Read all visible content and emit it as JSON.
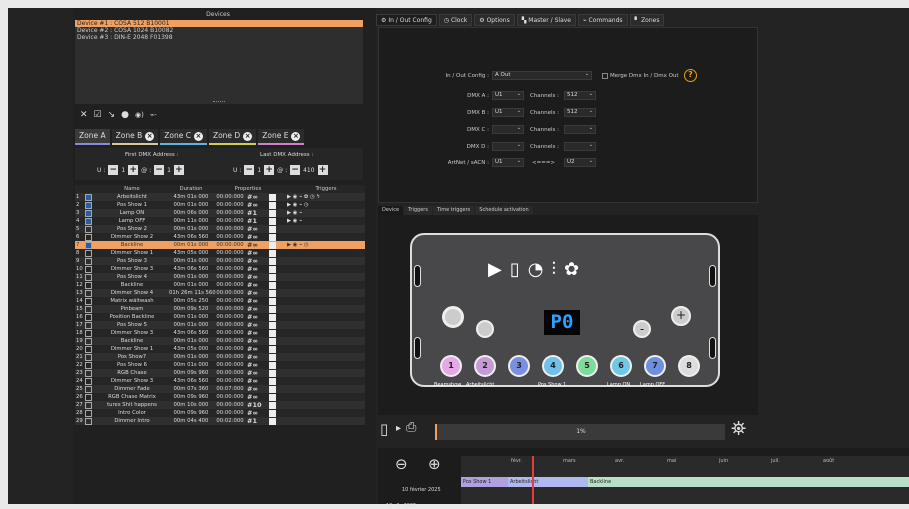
{
  "devices": {
    "title": "Devices",
    "items": [
      "Device #1 : COSA 512 B10001",
      "Device #2 : COSA 1024 B10082",
      "Device #3 : DIN-E 2048 F01398"
    ]
  },
  "zones": [
    "Zone A",
    "Zone B",
    "Zone C",
    "Zone D",
    "Zone E"
  ],
  "addr": {
    "first_label": "First DMX Address :",
    "last_label": "Last DMX Address :",
    "u": "U :",
    "at": "@ :",
    "first_u": "1",
    "first_at": "1",
    "last_u": "1",
    "last_at": "410"
  },
  "table": {
    "headers": [
      "Name",
      "Duration",
      "Properties",
      "Triggers"
    ],
    "rows": [
      {
        "n": "1",
        "name": "Arbeitslicht",
        "dur": "43m 01s 000",
        "prop": "00:00:000",
        "hash": "#∞",
        "on": true,
        "trg": "▶ ◉ ⌁ ✿ ◷ ϟ"
      },
      {
        "n": "2",
        "name": "Pos Show 1",
        "dur": "00m 01s 000",
        "prop": "00:00:000",
        "hash": "#∞",
        "on": true,
        "trg": "▶ ◉ ⌁       ◷"
      },
      {
        "n": "3",
        "name": "Lamp ON",
        "dur": "00m 06s 000",
        "prop": "00:00:000",
        "hash": "#1",
        "on": true,
        "trg": "▶ ◉ ⌁"
      },
      {
        "n": "4",
        "name": "Lamp OFF",
        "dur": "00m 11s 000",
        "prop": "00:00:000",
        "hash": "#1",
        "on": true,
        "trg": "▶ ◉ ⌁"
      },
      {
        "n": "5",
        "name": "Pos Show 2",
        "dur": "00m 01s 000",
        "prop": "00:00:000",
        "hash": "#∞",
        "on": false,
        "trg": ""
      },
      {
        "n": "6",
        "name": "Dimmer Show 2",
        "dur": "43m 06s 560",
        "prop": "00:00:000",
        "hash": "#∞",
        "on": false,
        "trg": ""
      },
      {
        "n": "7",
        "name": "Backline",
        "dur": "00m 01s 000",
        "prop": "00:00:000",
        "hash": "#∞",
        "on": true,
        "trg": "▶ ◉ ⌁       ◷",
        "sel": true
      },
      {
        "n": "8",
        "name": "Dimmer Show 1",
        "dur": "43m 05s 000",
        "prop": "00:00:000",
        "hash": "#∞",
        "on": false,
        "trg": ""
      },
      {
        "n": "9",
        "name": "Pos Show 3",
        "dur": "00m 01s 000",
        "prop": "00:00:000",
        "hash": "#∞",
        "on": false,
        "trg": ""
      },
      {
        "n": "10",
        "name": "Dimmer Show 3",
        "dur": "43m 06s 560",
        "prop": "00:00:000",
        "hash": "#∞",
        "on": false,
        "trg": ""
      },
      {
        "n": "11",
        "name": "Pos Show 4",
        "dur": "00m 01s 000",
        "prop": "00:00:000",
        "hash": "#∞",
        "on": false,
        "trg": ""
      },
      {
        "n": "12",
        "name": "Backline",
        "dur": "00m 01s 000",
        "prop": "00:00:000",
        "hash": "#∞",
        "on": false,
        "trg": ""
      },
      {
        "n": "13",
        "name": "Dimmer Show 4",
        "dur": "01h 26m 11s 560",
        "prop": "00:00:000",
        "hash": "#∞",
        "on": false,
        "trg": ""
      },
      {
        "n": "14",
        "name": "Matrix wäitwash",
        "dur": "00m 05s 250",
        "prop": "00:00:000",
        "hash": "#∞",
        "on": false,
        "trg": ""
      },
      {
        "n": "15",
        "name": "Pinbeam",
        "dur": "00m 09s 520",
        "prop": "00:00:000",
        "hash": "#∞",
        "on": false,
        "trg": ""
      },
      {
        "n": "16",
        "name": "Position Backline",
        "dur": "00m 01s 000",
        "prop": "00:00:000",
        "hash": "#∞",
        "on": false,
        "trg": ""
      },
      {
        "n": "17",
        "name": "Pos Show 5",
        "dur": "00m 01s 000",
        "prop": "00:00:000",
        "hash": "#∞",
        "on": false,
        "trg": ""
      },
      {
        "n": "18",
        "name": "Dimmer Show 3",
        "dur": "43m 06s 560",
        "prop": "00:00:000",
        "hash": "#∞",
        "on": false,
        "trg": ""
      },
      {
        "n": "19",
        "name": "Backline",
        "dur": "00m 01s 000",
        "prop": "00:00:000",
        "hash": "#∞",
        "on": false,
        "trg": ""
      },
      {
        "n": "20",
        "name": "Dimmer Show 1",
        "dur": "43m 05s 000",
        "prop": "00:00:000",
        "hash": "#∞",
        "on": false,
        "trg": ""
      },
      {
        "n": "21",
        "name": "Pos Show7",
        "dur": "00m 01s 000",
        "prop": "00:00:000",
        "hash": "#∞",
        "on": false,
        "trg": ""
      },
      {
        "n": "22",
        "name": "Pos Show 6",
        "dur": "00m 01s 000",
        "prop": "00:00:000",
        "hash": "#∞",
        "on": false,
        "trg": ""
      },
      {
        "n": "23",
        "name": "RGB Chase",
        "dur": "00m 09s 960",
        "prop": "00:00:000",
        "hash": "#∞",
        "on": false,
        "trg": ""
      },
      {
        "n": "24",
        "name": "Dimmer Show 3",
        "dur": "43m 06s 560",
        "prop": "00:00:000",
        "hash": "#∞",
        "on": false,
        "trg": ""
      },
      {
        "n": "25",
        "name": "Dimmer Fade",
        "dur": "00m 07s 360",
        "prop": "00:07:000",
        "hash": "#∞",
        "on": false,
        "trg": ""
      },
      {
        "n": "26",
        "name": "RGB Chase Matrix",
        "dur": "00m 09s 960",
        "prop": "00:00:000",
        "hash": "#∞",
        "on": false,
        "trg": ""
      },
      {
        "n": "27",
        "name": "tures Shit happens",
        "dur": "00m 10s 000",
        "prop": "00:00:000",
        "hash": "#10",
        "on": false,
        "trg": ""
      },
      {
        "n": "28",
        "name": "Intro Color",
        "dur": "00m 09s 960",
        "prop": "00:00:000",
        "hash": "#∞",
        "on": false,
        "trg": ""
      },
      {
        "n": "29",
        "name": "Dimmer Intro",
        "dur": "00m 04s 400",
        "prop": "00:02:000",
        "hash": "#1",
        "on": false,
        "trg": ""
      }
    ]
  },
  "tabs": [
    "In / Out Config",
    "Clock",
    "Options",
    "Master / Slave",
    "Commands",
    "Zones"
  ],
  "cfg": {
    "ioc_label": "In / Out Config :",
    "ioc_val": "A Out",
    "merge": "Merge Dmx In / Dmx Out",
    "rows": [
      {
        "l": "DMX A :",
        "u": "U1",
        "c": "512"
      },
      {
        "l": "DMX B :",
        "u": "U1",
        "c": "512"
      },
      {
        "l": "DMX C :",
        "u": "",
        "c": ""
      },
      {
        "l": "DMX D :",
        "u": "",
        "c": ""
      }
    ],
    "ch_label": "Channels :",
    "artnet_label": "ArtNet / sACN :",
    "artnet_u": "U1",
    "arrow": "<===>",
    "artnet_u2": "U2"
  },
  "subtabs": [
    "Device",
    "Triggers",
    "Time triggers",
    "Schedule activation"
  ],
  "device": {
    "display": "P0",
    "buttons": [
      {
        "n": "1",
        "c": "#e6a8e6"
      },
      {
        "n": "2",
        "c": "#c59ad6"
      },
      {
        "n": "3",
        "c": "#7a8fe0"
      },
      {
        "n": "4",
        "c": "#6fc0ea"
      },
      {
        "n": "5",
        "c": "#7edc9a"
      },
      {
        "n": "6",
        "c": "#6fc8e8"
      },
      {
        "n": "7",
        "c": "#6c8fe0"
      },
      {
        "n": "8",
        "c": "#dddddd"
      }
    ],
    "labels": [
      "Beamshow",
      "Arbeitslicht",
      "Pos Show 1",
      "Lamp ON",
      "Lamp OFF"
    ]
  },
  "progress": "1%",
  "timeline": {
    "date": "10 février 2025",
    "months": [
      "févr.",
      "mars",
      "avr.",
      "mai",
      "juin",
      "juil.",
      "août"
    ],
    "clips": [
      "Pos Show 1",
      "Arbeitslicht",
      "Backline"
    ],
    "day": "10",
    "month": "2",
    "year": "2025"
  }
}
